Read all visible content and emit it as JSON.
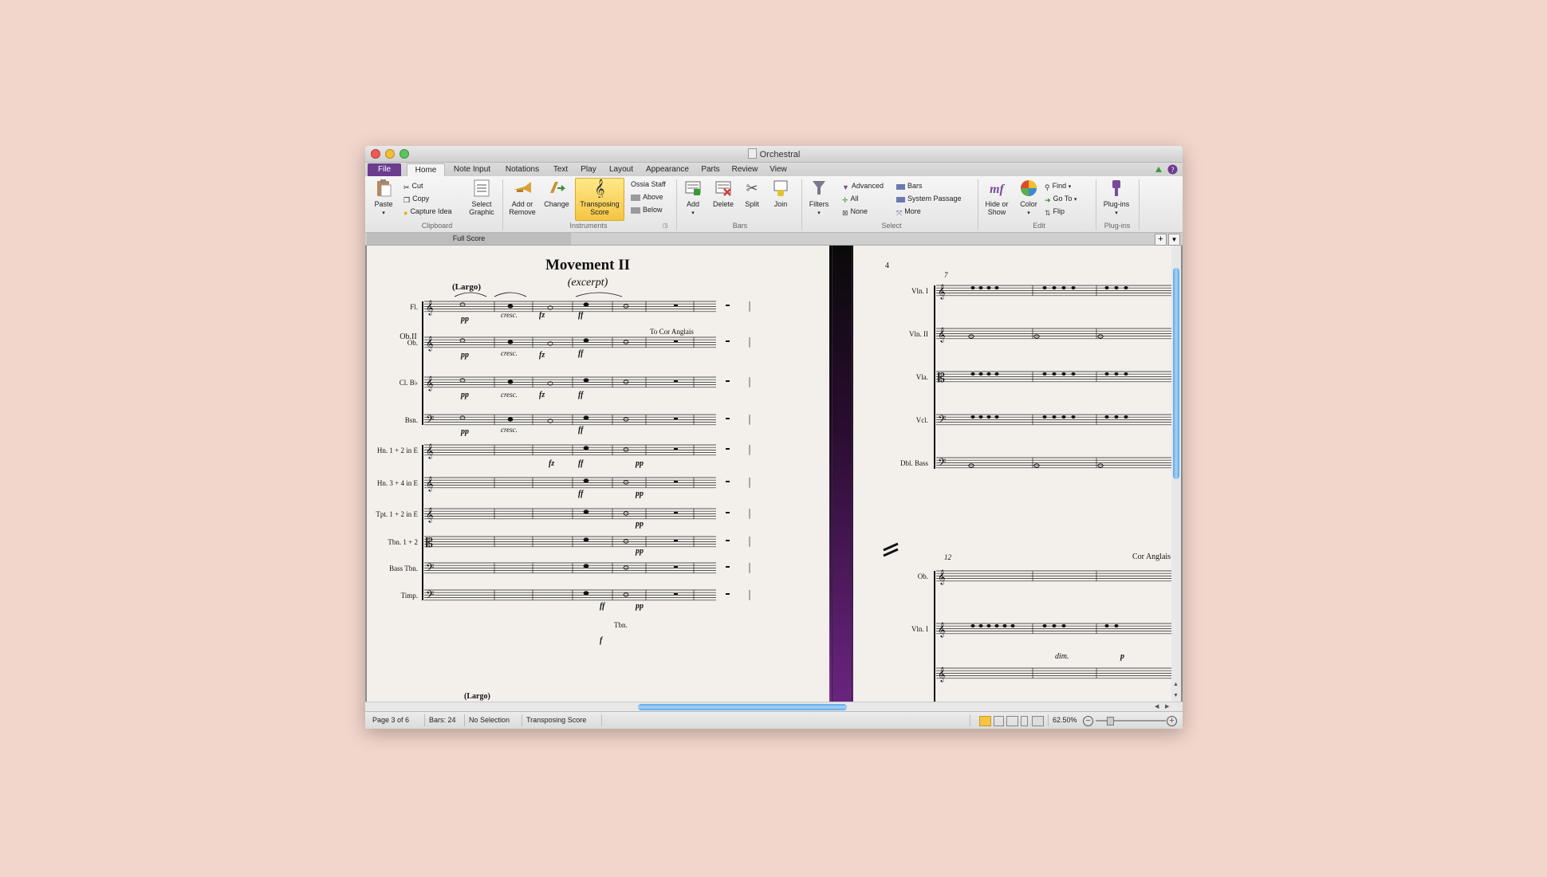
{
  "window": {
    "title": "Orchestral"
  },
  "tabs": [
    {
      "label": "File"
    },
    {
      "label": "Home"
    },
    {
      "label": "Note Input"
    },
    {
      "label": "Notations"
    },
    {
      "label": "Text"
    },
    {
      "label": "Play"
    },
    {
      "label": "Layout"
    },
    {
      "label": "Appearance"
    },
    {
      "label": "Parts"
    },
    {
      "label": "Review"
    },
    {
      "label": "View"
    }
  ],
  "ribbon": {
    "clipboard": {
      "paste": "Paste",
      "cut": "Cut",
      "copy": "Copy",
      "capture_idea": "Capture Idea",
      "select_graphic_1": "Select",
      "select_graphic_2": "Graphic",
      "label": "Clipboard"
    },
    "instruments": {
      "add_remove_1": "Add or",
      "add_remove_2": "Remove",
      "change": "Change",
      "transposing_1": "Transposing",
      "transposing_2": "Score",
      "ossia_staff": "Ossia Staff",
      "above": "Above",
      "below": "Below",
      "label": "Instruments"
    },
    "bars": {
      "add": "Add",
      "delete": "Delete",
      "split": "Split",
      "join": "Join",
      "label": "Bars"
    },
    "select": {
      "filters": "Filters",
      "advanced": "Advanced",
      "all": "All",
      "none": "None",
      "bars": "Bars",
      "system_passage": "System Passage",
      "more": "More",
      "label": "Select"
    },
    "edit": {
      "hide_show_1": "Hide or",
      "hide_show_2": "Show",
      "color": "Color",
      "find": "Find",
      "go_to": "Go To",
      "flip": "Flip",
      "label": "Edit"
    },
    "plugins": {
      "plugins": "Plug-ins",
      "label": "Plug-ins"
    }
  },
  "score_tab": "Full Score",
  "score_left": {
    "title": "Movement II",
    "subtitle": "(excerpt)",
    "tempo": "(Largo)",
    "tempo_bottom": "(Largo)",
    "instruments": [
      "Fl.",
      "Ob.",
      "Cl. B♭",
      "Bsn.",
      "Hn. 1 + 2 in E",
      "Hn. 3 + 4 in E",
      "Tpt. 1 + 2 in E",
      "Tbn. 1 + 2",
      "Bass Tbn.",
      "Timp."
    ],
    "annotations": {
      "ob2": "Ob.II",
      "cor": "To Cor Anglais",
      "tbn": "Tbn."
    },
    "dynamics": {
      "pp": "pp",
      "cresc": "cresc.",
      "fz": "fz",
      "ff": "ff",
      "p": "p",
      "f": "f"
    }
  },
  "score_right": {
    "page_number": "4",
    "bar_7": "7",
    "bar_12": "12",
    "instruments_top": [
      "Vln. I",
      "Vln. II",
      "Vla.",
      "Vcl.",
      "Dbl. Bass"
    ],
    "instruments_bottom": [
      "Ob.",
      "Vln. I"
    ],
    "cor_anglais": "Cor Anglais",
    "dim": "dim.",
    "p": "p"
  },
  "status": {
    "page": "Page 3 of 6",
    "bars": "Bars: 24",
    "selection": "No Selection",
    "mode": "Transposing Score",
    "zoom": "62.50%"
  },
  "colors": {
    "file_tab": "#6b3c8f",
    "scroll_thumb": "#5aa7ea",
    "highlight": "#f5c542",
    "page_bg": "#f2d6cc"
  }
}
